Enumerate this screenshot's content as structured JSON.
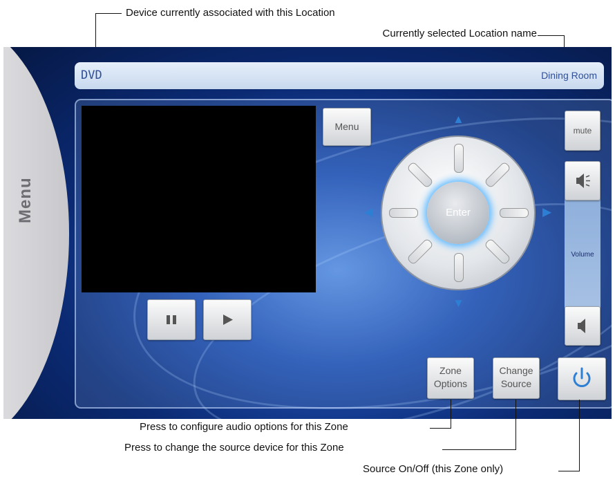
{
  "annotations": {
    "device_callout": "Device currently associated with this Location",
    "location_callout": "Currently selected Location name",
    "zone_options_callout": "Press to configure audio options for this Zone",
    "change_source_callout": "Press to change the source device for this Zone",
    "power_callout": "Source On/Off (this Zone only)"
  },
  "header": {
    "device_name": "DVD",
    "location_name": "Dining Room"
  },
  "side_menu": {
    "label": "Menu"
  },
  "controls": {
    "menu_label": "Menu",
    "enter_label": "Enter",
    "mute_label": "mute",
    "volume_label": "Volume",
    "zone_options_label": [
      "Zone",
      "Options"
    ],
    "change_source_label": [
      "Change",
      "Source"
    ]
  },
  "icons": {
    "pause": "pause-icon",
    "play": "play-icon",
    "volume_up": "volume-up-icon",
    "volume_down": "volume-down-icon",
    "power": "power-icon"
  },
  "colors": {
    "accent": "#2d7fd4",
    "panel": "#1f4fb0"
  }
}
